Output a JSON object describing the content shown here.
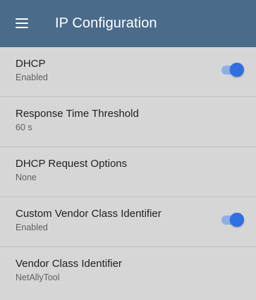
{
  "app_bar": {
    "title": "IP Configuration",
    "menu_icon": "menu-icon"
  },
  "colors": {
    "app_bar": "#4a6b8a",
    "background": "#d6d6d6",
    "toggle_on": "#2f6fe4",
    "toggle_track": "#8bb0e8"
  },
  "settings": [
    {
      "title": "DHCP",
      "value": "Enabled",
      "toggle": true,
      "toggle_on": true
    },
    {
      "title": "Response Time Threshold",
      "value": "60 s",
      "toggle": false
    },
    {
      "title": "DHCP Request Options",
      "value": "None",
      "toggle": false
    },
    {
      "title": "Custom Vendor Class Identifier",
      "value": "Enabled",
      "toggle": true,
      "toggle_on": true
    },
    {
      "title": "Vendor Class Identifier",
      "value": "NetAllyTool",
      "toggle": false
    }
  ]
}
